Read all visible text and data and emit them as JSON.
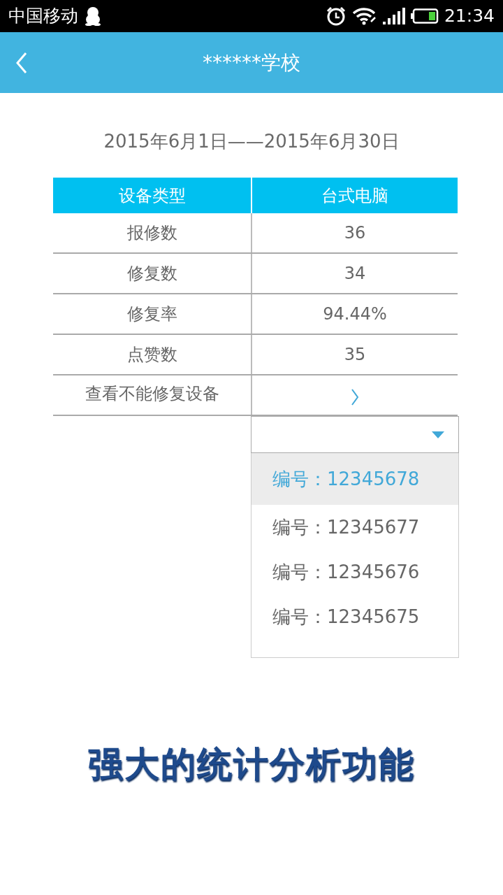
{
  "status_bar": {
    "carrier": "中国移动",
    "time": "21:34"
  },
  "header": {
    "title": "******学校"
  },
  "date_range": "2015年6月1日——2015年6月30日",
  "table": {
    "columns": [
      "设备类型",
      "台式电脑"
    ],
    "rows": [
      {
        "kind": "value",
        "label": "报修数",
        "value": "36"
      },
      {
        "kind": "value",
        "label": "修复数",
        "value": "34"
      },
      {
        "kind": "value",
        "label": "修复率",
        "value": "94.44%"
      },
      {
        "kind": "value",
        "label": "点赞数",
        "value": "35"
      },
      {
        "kind": "link",
        "label": "查看不能修复设备"
      }
    ]
  },
  "dropdown": {
    "expanded": true,
    "options": [
      {
        "label": "编号：12345678",
        "selected": true
      },
      {
        "label": "编号：12345677",
        "selected": false
      },
      {
        "label": "编号：12345676",
        "selected": false
      },
      {
        "label": "编号：12345675",
        "selected": false
      }
    ]
  },
  "slogan": "强大的统计分析功能"
}
